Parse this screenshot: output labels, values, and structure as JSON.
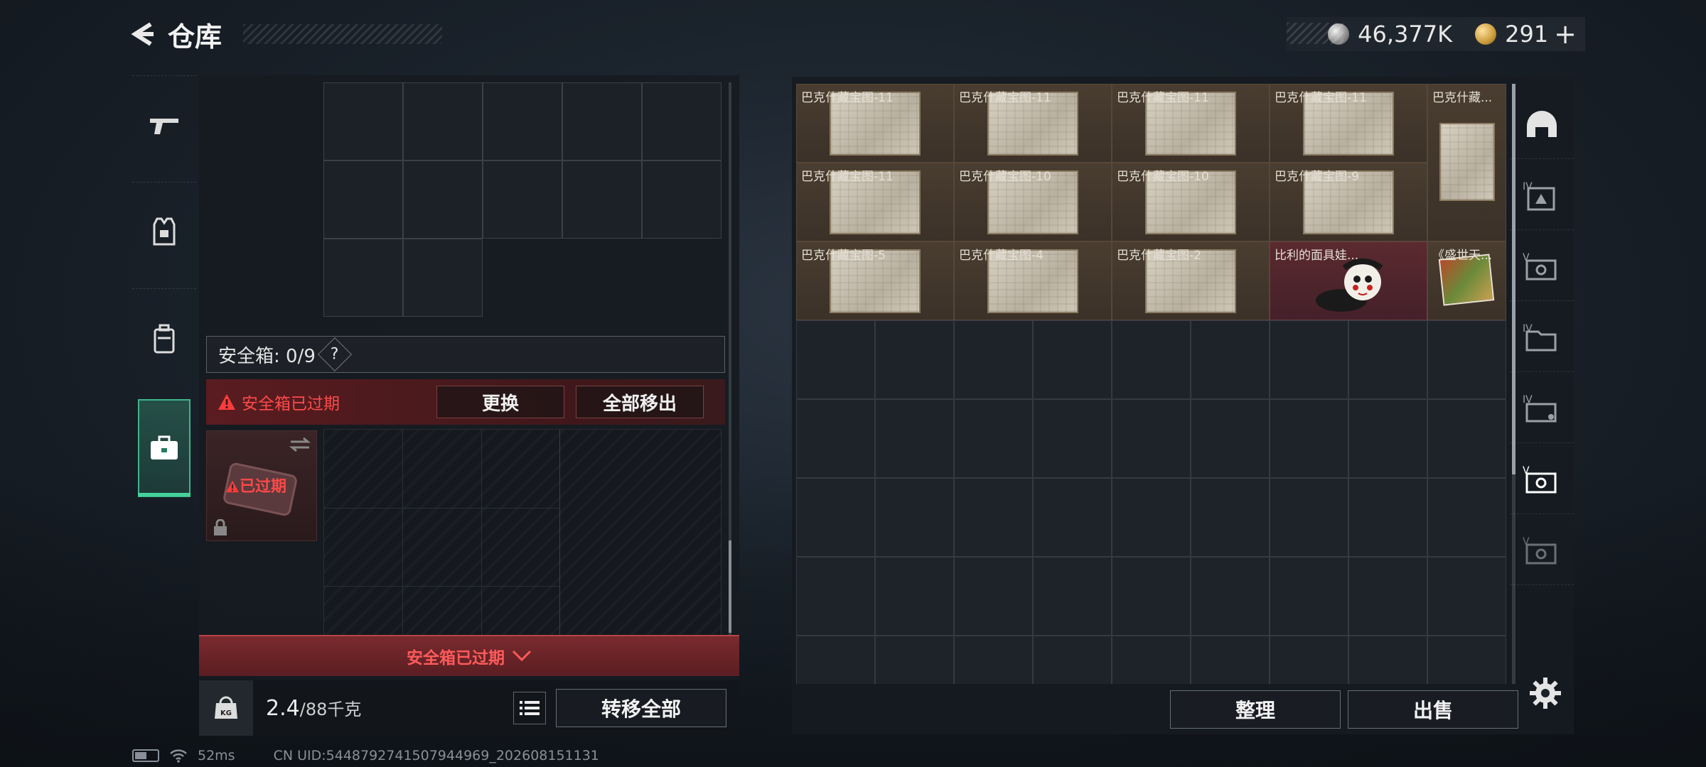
{
  "header": {
    "title": "仓库"
  },
  "currency": {
    "silver": "46,377K",
    "gold": "291",
    "plus": "+"
  },
  "left_tabs": [
    {
      "icon": "gun-icon"
    },
    {
      "icon": "vest-icon"
    },
    {
      "icon": "backpack-icon"
    },
    {
      "icon": "case-icon",
      "active": true
    }
  ],
  "safebox": {
    "label": "安全箱: 0/9",
    "help": "?",
    "expired_warning": "安全箱已过期",
    "replace_button": "更换",
    "remove_all_button": "全部移出",
    "case_status": "已过期",
    "footer_text": "安全箱已过期"
  },
  "bottom": {
    "weight_current": "2.4",
    "weight_sep": "/",
    "weight_max": "88千克",
    "kg_icon_text": "KG",
    "transfer_all": "转移全部"
  },
  "stash": {
    "items": [
      {
        "name": "巴克什藏宝图-11",
        "type": "map"
      },
      {
        "name": "巴克什藏宝图-11",
        "type": "map"
      },
      {
        "name": "巴克什藏宝图-11",
        "type": "map"
      },
      {
        "name": "巴克什藏宝图-11",
        "type": "map"
      },
      {
        "name": "巴克什藏...",
        "type": "map"
      },
      {
        "name": "巴克什藏宝图-11",
        "type": "map"
      },
      {
        "name": "巴克什藏宝图-10",
        "type": "map"
      },
      {
        "name": "巴克什藏宝图-10",
        "type": "map"
      },
      {
        "name": "巴克什藏宝图-9",
        "type": "map"
      },
      {
        "name": "巴克什藏宝图-5",
        "type": "map"
      },
      {
        "name": "巴克什藏宝图-4",
        "type": "map"
      },
      {
        "name": "巴克什藏宝图-2",
        "type": "map"
      },
      {
        "name": "比利的面具娃...",
        "type": "doll"
      },
      {
        "name": "《盛世天...",
        "type": "book"
      }
    ],
    "sort_button": "整理",
    "sell_button": "出售"
  },
  "right_rail": [
    {
      "icon": "helmet-icon"
    },
    {
      "icon": "armor-iv-icon"
    },
    {
      "icon": "case-v-icon"
    },
    {
      "icon": "folder-iv-icon"
    },
    {
      "icon": "wallet-iv-icon"
    },
    {
      "icon": "case-v-selected-icon"
    },
    {
      "icon": "case-v-dim-icon"
    }
  ],
  "status": {
    "ping": "52ms",
    "uid": "CN UID:5448792741507944969_202608151131"
  }
}
